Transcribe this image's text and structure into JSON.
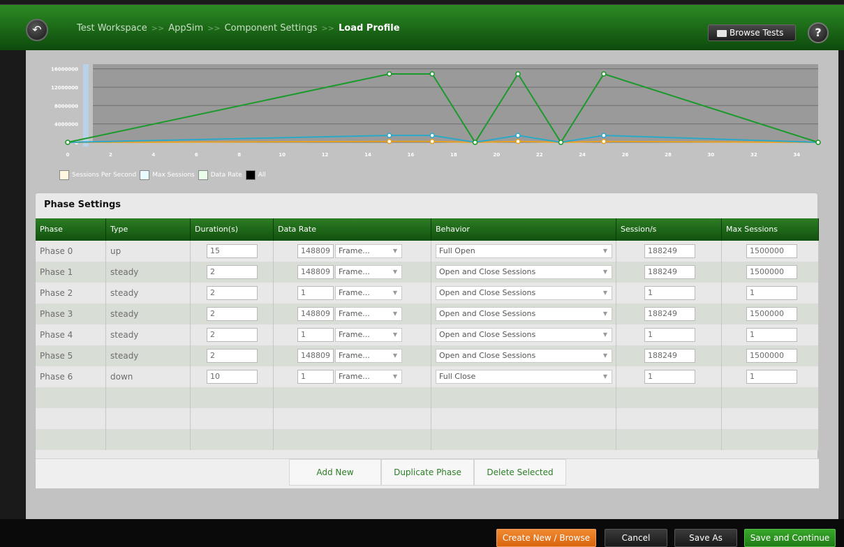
{
  "breadcrumb": {
    "items": [
      "Test Workspace",
      "AppSim",
      "Component Settings"
    ],
    "current": "Load Profile",
    "separator": ">>"
  },
  "header": {
    "browse_tests_label": "Browse Tests",
    "help_label": "?"
  },
  "chart_data": {
    "type": "line",
    "x": [
      0,
      15,
      17,
      19,
      21,
      23,
      25,
      35
    ],
    "xlim": [
      0,
      35
    ],
    "x_ticks": [
      0,
      2,
      4,
      6,
      8,
      10,
      12,
      14,
      16,
      18,
      20,
      22,
      24,
      26,
      28,
      30,
      32,
      34
    ],
    "ylim": [
      0,
      17000000
    ],
    "y_ticks": [
      0,
      4000000,
      8000000,
      12000000,
      16000000
    ],
    "y_tick_labels": [
      "0",
      "4000000",
      "8000000",
      "12000000",
      "16000000"
    ],
    "series": [
      {
        "name": "Sessions Per Second",
        "color": "#e8a020",
        "values": [
          0,
          188249,
          188249,
          1,
          188249,
          1,
          188249,
          1
        ]
      },
      {
        "name": "Max Sessions",
        "color": "#2aa8c8",
        "values": [
          0,
          1500000,
          1500000,
          1,
          1500000,
          1,
          1500000,
          1
        ]
      },
      {
        "name": "Data Rate",
        "color": "#1a9a2a",
        "values": [
          0,
          14880952,
          14880952,
          1,
          14880952,
          1,
          14880952,
          1
        ]
      }
    ],
    "legend": [
      {
        "label": "Sessions Per Second",
        "swatch": "#fff8e0"
      },
      {
        "label": "Max Sessions",
        "swatch": "#e8fbff"
      },
      {
        "label": "Data Rate",
        "swatch": "#eafde8"
      },
      {
        "label": "All",
        "swatch": "#000000"
      }
    ],
    "grid": true
  },
  "phase_settings": {
    "title": "Phase Settings",
    "columns": [
      "Phase",
      "Type",
      "Duration(s)",
      "Data Rate",
      "Behavior",
      "Session/s",
      "Max Sessions"
    ],
    "rows": [
      {
        "phase": "Phase 0",
        "type": "up",
        "duration": "15",
        "rate": "148809",
        "unit": "Frame...",
        "behavior": "Full Open",
        "sessions": "188249",
        "max": "1500000"
      },
      {
        "phase": "Phase 1",
        "type": "steady",
        "duration": "2",
        "rate": "148809",
        "unit": "Frame...",
        "behavior": "Open and Close Sessions",
        "sessions": "188249",
        "max": "1500000"
      },
      {
        "phase": "Phase 2",
        "type": "steady",
        "duration": "2",
        "rate": "1",
        "unit": "Frame...",
        "behavior": "Open and Close Sessions",
        "sessions": "1",
        "max": "1"
      },
      {
        "phase": "Phase 3",
        "type": "steady",
        "duration": "2",
        "rate": "148809",
        "unit": "Frame...",
        "behavior": "Open and Close Sessions",
        "sessions": "188249",
        "max": "1500000"
      },
      {
        "phase": "Phase 4",
        "type": "steady",
        "duration": "2",
        "rate": "1",
        "unit": "Frame...",
        "behavior": "Open and Close Sessions",
        "sessions": "1",
        "max": "1"
      },
      {
        "phase": "Phase 5",
        "type": "steady",
        "duration": "2",
        "rate": "148809",
        "unit": "Frame...",
        "behavior": "Open and Close Sessions",
        "sessions": "188249",
        "max": "1500000"
      },
      {
        "phase": "Phase 6",
        "type": "down",
        "duration": "10",
        "rate": "1",
        "unit": "Frame...",
        "behavior": "Full Close",
        "sessions": "1",
        "max": "1"
      }
    ],
    "add_new_label": "Add New",
    "duplicate_label": "Duplicate Phase",
    "delete_label": "Delete Selected"
  },
  "footer": {
    "create_browse_label": "Create New / Browse",
    "cancel_label": "Cancel",
    "save_as_label": "Save As",
    "save_continue_label": "Save and Continue"
  },
  "colors": {
    "header_green": "#1e6e18",
    "accent_orange": "#e8731a",
    "accent_green": "#2a9a1e"
  }
}
